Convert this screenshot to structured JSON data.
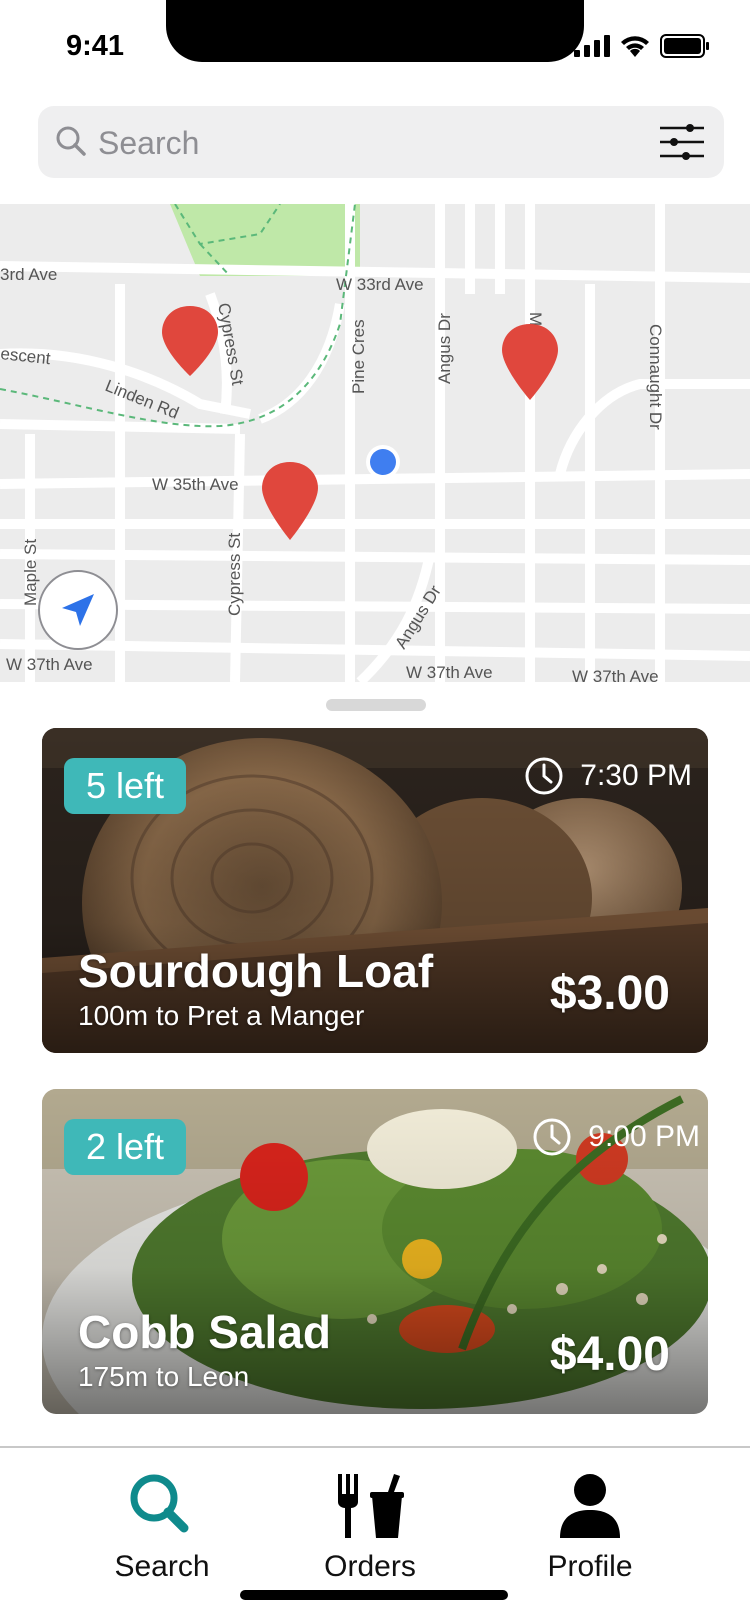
{
  "status_bar": {
    "time": "9:41"
  },
  "search": {
    "placeholder": "Search"
  },
  "map": {
    "street_labels": [
      "3rd Ave",
      "W 33rd Ave",
      "escent",
      "Linden Rd",
      "Cypress St",
      "Pine Cres",
      "Angus Dr",
      "Margaret St",
      "Connaught Dr",
      "W 35th Ave",
      "Maple St",
      "Cypress St",
      "Angus Dr",
      "W 37th Ave",
      "W 37th Ave",
      "W 37th Ave"
    ],
    "street_labels_visible": [
      "3rd Ave",
      "W 33rd Ave",
      "escent",
      "Linden Rd",
      "Cypress St",
      "Pine Cres",
      "Angus Dr",
      "Marga",
      "Connaught Dr",
      "W 35th Ave",
      "Maple St",
      "Cypress St",
      "Angus Dr",
      "W 37th Ave",
      "W 37th Ave",
      "W 37th Ave"
    ],
    "pin_color": "#e0473d",
    "user_dot_color": "#3f7ef0"
  },
  "cards": [
    {
      "badge": "5 left",
      "time": "7:30 PM",
      "title": "Sourdough Loaf",
      "subtitle": "100m to Pret a Manger",
      "price": "$3.00"
    },
    {
      "badge": "2 left",
      "time": "9:00 PM",
      "title": "Cobb Salad",
      "subtitle": "175m to Leon",
      "price": "$4.00"
    }
  ],
  "tabs": [
    {
      "label": "Search",
      "icon": "magnifier-icon",
      "active": true
    },
    {
      "label": "Orders",
      "icon": "fork-and-cup-icon",
      "active": false
    },
    {
      "label": "Profile",
      "icon": "person-icon",
      "active": false
    }
  ],
  "colors": {
    "accent": "#0f8a8c",
    "badge": "#3fb8b8"
  }
}
